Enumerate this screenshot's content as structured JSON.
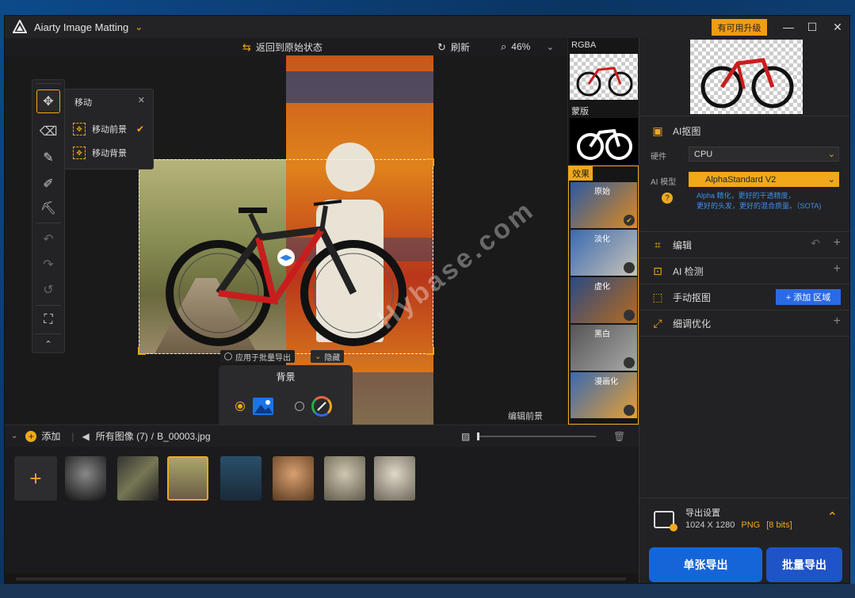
{
  "app": {
    "title": "Aiarty Image Matting",
    "upgrade_label": "有可用升级"
  },
  "toolbar": {
    "reset_label": "返回到原始状态",
    "refresh_label": "刷新",
    "zoom": "46%"
  },
  "tools_popup": {
    "title": "移动",
    "items": [
      "移动前景",
      "移动背景"
    ],
    "selected": "移动前景"
  },
  "canvas": {
    "apply_batch_label": "应用于批量导出",
    "hide_label": "隐藏",
    "edit_fg_label": "编辑前景",
    "watermark": "Hybase.com"
  },
  "background_panel": {
    "title": "背景"
  },
  "thumb_panel": {
    "rgba_label": "RGBA",
    "mask_label": "蒙版",
    "effects_label": "效果",
    "effect_items": [
      "原始",
      "淡化",
      "虚化",
      "黑白",
      "漫画化"
    ]
  },
  "right_panel": {
    "ai_section": {
      "title": "AI抠图",
      "hardware_label": "硬件",
      "hardware_value": "CPU",
      "model_label": "AI 模型",
      "model_value": "AlphaStandard V2",
      "model_desc_line1": "Alpha 精化，更好的干透精度，",
      "model_desc_line2": "更好的头发，更好的混合质量。（SOTA)"
    },
    "rows": [
      {
        "label": "编辑",
        "icon": "edit-icon"
      },
      {
        "label": "AI 检测",
        "icon": "ai-detect-icon"
      },
      {
        "label": "手动抠图",
        "icon": "manual-icon",
        "button": "+ 添加 区域"
      },
      {
        "label": "细调优化",
        "icon": "refine-icon"
      }
    ],
    "export": {
      "title": "导出设置",
      "size": "1024 X 1280",
      "format": "PNG",
      "bits": "[8 bits]"
    },
    "single_export": "单张导出",
    "batch_export": "批量导出"
  },
  "bottom": {
    "add_label": "添加",
    "breadcrumb_all": "所有图像 (7)",
    "breadcrumb_sep": "/",
    "file_name": "B_00003.jpg"
  },
  "colors": {
    "accent": "#f1a81a",
    "primary": "#1466d8",
    "bg": "#1c1c1e"
  }
}
